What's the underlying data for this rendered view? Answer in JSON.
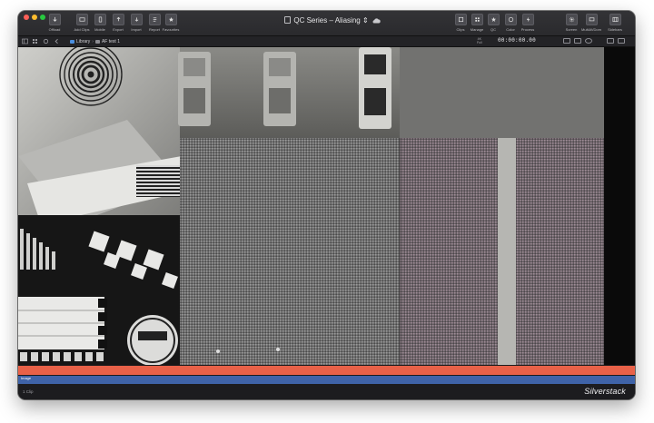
{
  "window": {
    "title": "QC Series – Aliasing",
    "title_suffix": "⇕"
  },
  "toolbar": {
    "left_buttons": [
      {
        "label": "Offload",
        "icon": "offload-icon"
      },
      {
        "label": "Add Clips",
        "icon": "add-clips-icon"
      },
      {
        "label": "Mobile",
        "icon": "mobile-icon"
      },
      {
        "label": "Export",
        "icon": "export-icon"
      },
      {
        "label": "Import",
        "icon": "import-icon"
      },
      {
        "label": "Report",
        "icon": "report-icon"
      },
      {
        "label": "Favourites",
        "icon": "favourites-icon"
      }
    ],
    "right_buttons": [
      {
        "label": "Clips",
        "icon": "clips-icon"
      },
      {
        "label": "Manage",
        "icon": "manage-icon"
      },
      {
        "label": "QC",
        "icon": "qc-icon"
      },
      {
        "label": "Color",
        "icon": "color-icon"
      },
      {
        "label": "Process",
        "icon": "process-icon"
      },
      {
        "label": "Screen",
        "icon": "screen-icon"
      },
      {
        "label": "MultiAVDom",
        "icon": "multiavdom-icon"
      },
      {
        "label": "Sidebars",
        "icon": "sidebars-icon"
      }
    ]
  },
  "subbar": {
    "breadcrumb_library": "Library",
    "breadcrumb_clip": "AF test 1",
    "info_top": "4K",
    "info_bottom": "Full",
    "timecode": "00:00:00.00"
  },
  "timeline": {
    "blue_track_label": "Image"
  },
  "statusbar": {
    "text": "1 Clip",
    "brand": "Silverstack"
  },
  "colors": {
    "orange_track": "#e86148",
    "blue_track": "#3f63a8",
    "close": "#ff5f57",
    "minimize": "#febc2e",
    "maximize": "#28c840"
  }
}
